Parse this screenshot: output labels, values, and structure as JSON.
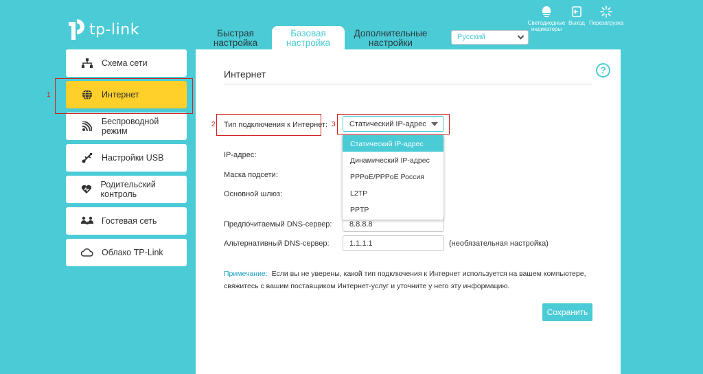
{
  "brand": {
    "name": "tp-link"
  },
  "tabs": [
    {
      "label": "Быстрая настройка"
    },
    {
      "label": "Базовая настройка"
    },
    {
      "label": "Дополнительные настройки"
    }
  ],
  "language": {
    "selected": "Русский"
  },
  "topbar": {
    "led_label": "Светодиодные индикаторы",
    "logout_label": "Выход",
    "reboot_label": "Перезагрузка"
  },
  "sidebar": {
    "items": [
      {
        "label": "Схема сети",
        "icon": "network-map-icon"
      },
      {
        "label": "Интернет",
        "icon": "globe-icon"
      },
      {
        "label": "Беспроводной режим",
        "icon": "wireless-icon"
      },
      {
        "label": "Настройки USB",
        "icon": "usb-icon"
      },
      {
        "label": "Родительский контроль",
        "icon": "heart-icon"
      },
      {
        "label": "Гостевая сеть",
        "icon": "guest-icon"
      },
      {
        "label": "Облако TP-Link",
        "icon": "cloud-icon"
      }
    ]
  },
  "markers": {
    "m1": "1",
    "m2": "2",
    "m3": "3"
  },
  "main": {
    "section_title": "Интернет",
    "connection_type_label": "Тип подключения к Интернет:",
    "connection_type_value": "Статический IP-адрес",
    "connection_options": [
      "Статический IP-адрес",
      "Динамический IP-адрес",
      "PPPoE/PPPoE Россия",
      "L2TP",
      "PPTP"
    ],
    "ip_label": "IP-адрес:",
    "mask_label": "Маска подсети:",
    "gateway_label": "Основной шлюз:",
    "dns1_label": "Предпочитаемый DNS-сервер:",
    "dns1_value": "8.8.8.8",
    "dns2_label": "Альтернативный DNS-сервер:",
    "dns2_value": "1.1.1.1",
    "optional_note": "(необязательная настройка)",
    "note_label": "Примечание:",
    "note_text": "Если вы не уверены, какой тип подключения к Интернет используется на вашем компьютере, свяжитесь с вашим поставщиком Интернет-услуг и уточните у него эту информацию.",
    "save_label": "Сохранить"
  },
  "colors": {
    "accent": "#4acbd6",
    "active_menu": "#ffcf2a",
    "marker": "#d12020"
  }
}
